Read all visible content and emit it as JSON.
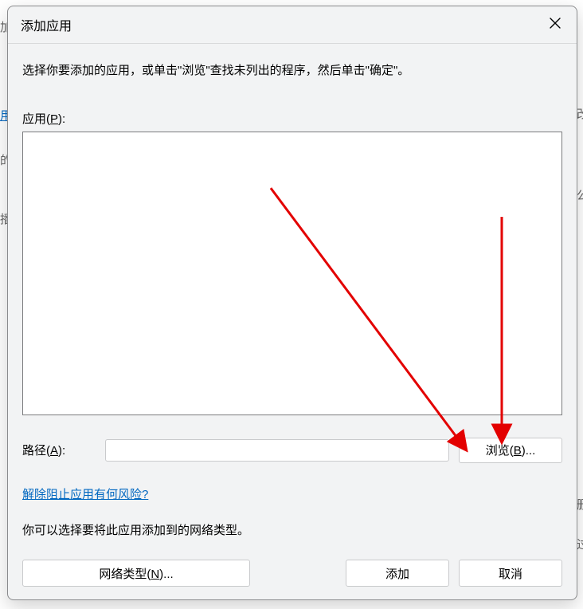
{
  "dialog": {
    "title": "添加应用",
    "instruction": "选择你要添加的应用，或单击\"浏览\"查找未列出的程序，然后单击\"确定\"。",
    "app_list_label": "应用(P):",
    "path_label": "路径(A):",
    "path_value": "",
    "browse_button": "浏览(B)...",
    "risk_link": "解除阻止应用有何风险?",
    "network_type_text": "你可以选择要将此应用添加到的网络类型。",
    "network_type_button": "网络类型(N)...",
    "add_button": "添加",
    "cancel_button": "取消"
  },
  "behind": {
    "frag_top_left": "加",
    "frag_2": "用",
    "frag_3": "的",
    "frag_4": "公",
    "frag_5": "播",
    "frag_6": "删",
    "frag_7": "改",
    "frag_bottom": "过"
  }
}
